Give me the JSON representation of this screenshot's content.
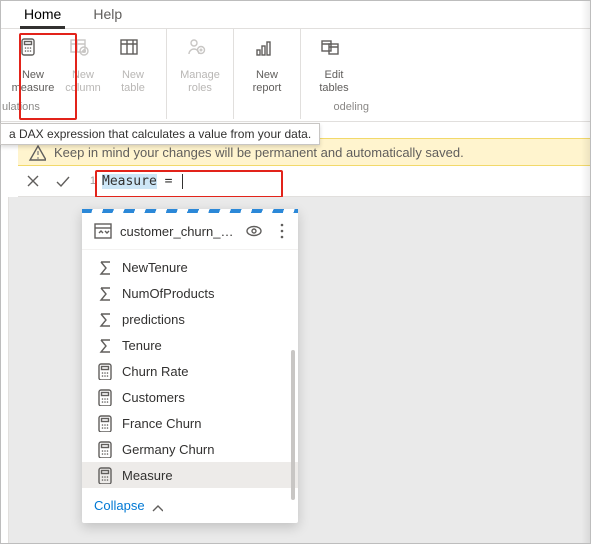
{
  "tabs": {
    "home": "Home",
    "help": "Help"
  },
  "ribbon": {
    "new_measure": "New\nmeasure",
    "new_column": "New\ncolumn",
    "new_table": "New\ntable",
    "manage_roles": "Manage\nroles",
    "new_report": "New\nreport",
    "edit_tables": "Edit\ntables",
    "group_left_partial": "ulations",
    "group_right_partial": "odeling"
  },
  "tooltip": "a DAX expression that calculates a value from your data.",
  "notice": "Keep in mind your changes will be permanent and automatically saved.",
  "formula": {
    "line": "1",
    "text": "Measure",
    "suffix": " = "
  },
  "pane": {
    "title": "customer_churn_test_...",
    "collapse": "Collapse"
  },
  "fields": [
    {
      "icon": "sigma",
      "label": "NewTenure"
    },
    {
      "icon": "sigma",
      "label": "NumOfProducts"
    },
    {
      "icon": "sigma",
      "label": "predictions"
    },
    {
      "icon": "sigma",
      "label": "Tenure"
    },
    {
      "icon": "calc",
      "label": "Churn Rate"
    },
    {
      "icon": "calc",
      "label": "Customers"
    },
    {
      "icon": "calc",
      "label": "France Churn"
    },
    {
      "icon": "calc",
      "label": "Germany Churn"
    },
    {
      "icon": "calc",
      "label": "Measure",
      "selected": true
    }
  ]
}
